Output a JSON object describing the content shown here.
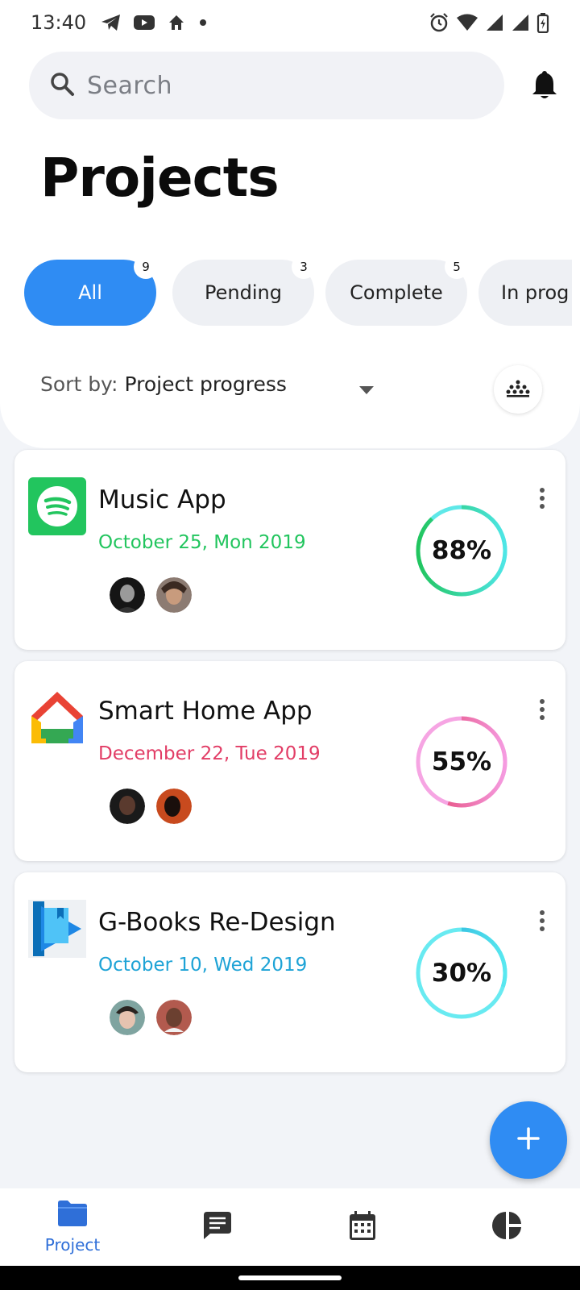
{
  "status_bar": {
    "time": "13:40",
    "left_icons": [
      "telegram-icon",
      "youtube-icon",
      "home-icon",
      "dot-icon"
    ],
    "right_icons": [
      "alarm-icon",
      "wifi-icon",
      "signal-icon",
      "signal-icon",
      "battery-icon"
    ]
  },
  "search": {
    "placeholder": "Search"
  },
  "page_title": "Projects",
  "tabs": [
    {
      "label": "All",
      "count": "9",
      "active": true
    },
    {
      "label": "Pending",
      "count": "3",
      "active": false
    },
    {
      "label": "Complete",
      "count": "5",
      "active": false
    },
    {
      "label": "In prog",
      "count": "",
      "active": false
    }
  ],
  "sort": {
    "label": "Sort by:",
    "value": "Project progress"
  },
  "projects": [
    {
      "title": "Music App",
      "date": "October 25, Mon 2019",
      "progress": 88,
      "progress_label": "88%",
      "icon": "spotify-icon",
      "date_color": "#22c55e",
      "ring_colors": [
        "#22c55e",
        "#4ee6e6"
      ]
    },
    {
      "title": "Smart Home App",
      "date": "December 22, Tue 2019",
      "progress": 55,
      "progress_label": "55%",
      "icon": "google-home-icon",
      "date_color": "#e23d66",
      "ring_colors": [
        "#e23d66",
        "#f59be0"
      ]
    },
    {
      "title": "G-Books Re-Design",
      "date": "October 10, Wed 2019",
      "progress": 30,
      "progress_label": "30%",
      "icon": "google-play-books-icon",
      "date_color": "#1ea3d6",
      "ring_colors": [
        "#1ea3d6",
        "#58e8f0"
      ]
    }
  ],
  "fab_icon": "plus-icon",
  "bottom_nav": [
    {
      "label": "Project",
      "icon": "folder-icon",
      "active": true
    },
    {
      "label": "",
      "icon": "chat-icon",
      "active": false
    },
    {
      "label": "",
      "icon": "calendar-icon",
      "active": false
    },
    {
      "label": "",
      "icon": "pie-chart-icon",
      "active": false
    }
  ],
  "colors": {
    "accent": "#2f8cf3",
    "background": "#f2f4f8"
  }
}
